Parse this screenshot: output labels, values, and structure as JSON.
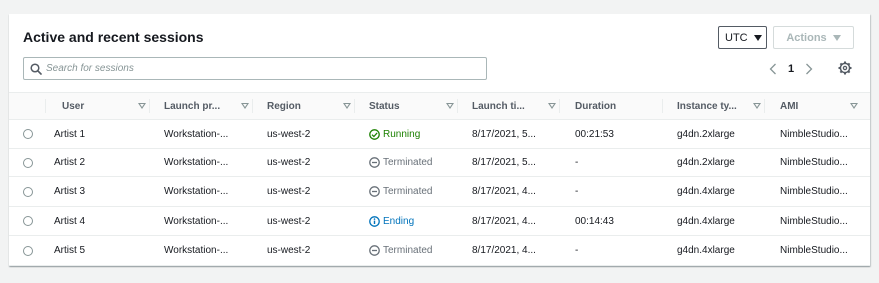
{
  "header": {
    "title": "Active and recent sessions",
    "timezone_label": "UTC",
    "actions_label": "Actions"
  },
  "search": {
    "placeholder": "Search for sessions",
    "value": ""
  },
  "pagination": {
    "current_page": "1"
  },
  "columns": [
    "User",
    "Launch pr...",
    "Region",
    "Status",
    "Launch ti...",
    "Duration",
    "Instance ty...",
    "AMI"
  ],
  "rows": [
    {
      "user": "Artist 1",
      "launch_profile": "Workstation-...",
      "region": "us-west-2",
      "status": "Running",
      "status_type": "running",
      "launch_time": "8/17/2021, 5...",
      "duration": "00:21:53",
      "instance_type": "g4dn.2xlarge",
      "ami": "NimbleStudio..."
    },
    {
      "user": "Artist 2",
      "launch_profile": "Workstation-...",
      "region": "us-west-2",
      "status": "Terminated",
      "status_type": "terminated",
      "launch_time": "8/17/2021, 5...",
      "duration": "-",
      "instance_type": "g4dn.2xlarge",
      "ami": "NimbleStudio..."
    },
    {
      "user": "Artist 3",
      "launch_profile": "Workstation-...",
      "region": "us-west-2",
      "status": "Terminated",
      "status_type": "terminated",
      "launch_time": "8/17/2021, 4...",
      "duration": "-",
      "instance_type": "g4dn.4xlarge",
      "ami": "NimbleStudio..."
    },
    {
      "user": "Artist 4",
      "launch_profile": "Workstation-...",
      "region": "us-west-2",
      "status": "Ending",
      "status_type": "ending",
      "launch_time": "8/17/2021, 4...",
      "duration": "00:14:43",
      "instance_type": "g4dn.4xlarge",
      "ami": "NimbleStudio..."
    },
    {
      "user": "Artist 5",
      "launch_profile": "Workstation-...",
      "region": "us-west-2",
      "status": "Terminated",
      "status_type": "terminated",
      "launch_time": "8/17/2021, 4...",
      "duration": "-",
      "instance_type": "g4dn.4xlarge",
      "ami": "NimbleStudio..."
    }
  ],
  "colors": {
    "running": "#1d8102",
    "terminated": "#687078",
    "ending": "#0073bb"
  }
}
